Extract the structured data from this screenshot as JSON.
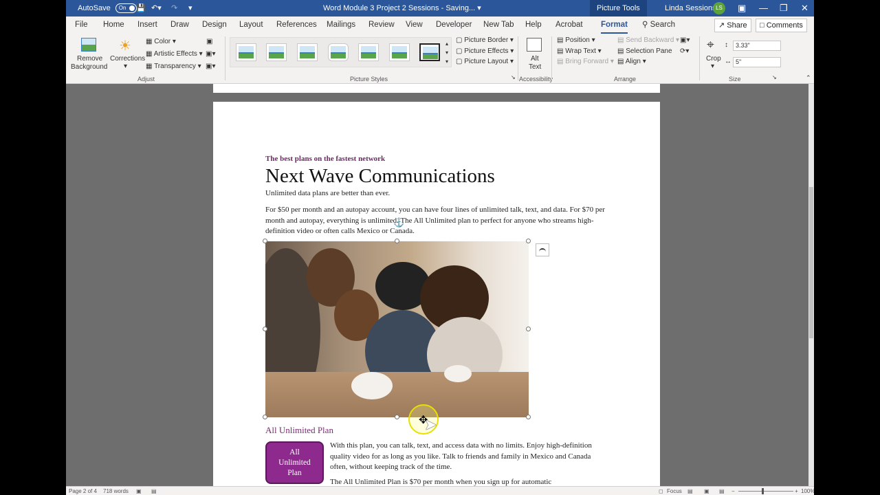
{
  "titlebar": {
    "autosave_label": "AutoSave",
    "autosave_state": "On",
    "document_title": "Word Module 3 Project 2 Sessions  -  Saving...",
    "context_tab": "Picture Tools",
    "user_name": "Linda Sessions",
    "user_initials": "LS"
  },
  "tabs": [
    {
      "label": "File"
    },
    {
      "label": "Home"
    },
    {
      "label": "Insert"
    },
    {
      "label": "Draw"
    },
    {
      "label": "Design"
    },
    {
      "label": "Layout"
    },
    {
      "label": "References"
    },
    {
      "label": "Mailings"
    },
    {
      "label": "Review"
    },
    {
      "label": "View"
    },
    {
      "label": "Developer"
    },
    {
      "label": "New Tab"
    },
    {
      "label": "Help"
    },
    {
      "label": "Acrobat"
    },
    {
      "label": "Format"
    }
  ],
  "search_label": "Search",
  "share_label": "Share",
  "comments_label": "Comments",
  "ribbon": {
    "remove_background_1": "Remove",
    "remove_background_2": "Background",
    "corrections": "Corrections",
    "color": "Color",
    "artistic_effects": "Artistic Effects",
    "transparency": "Transparency",
    "adjust_group": "Adjust",
    "picture_border": "Picture Border",
    "picture_effects": "Picture Effects",
    "picture_layout": "Picture Layout",
    "picture_styles_group": "Picture Styles",
    "alt_text_1": "Alt",
    "alt_text_2": "Text",
    "accessibility_group": "Accessibility",
    "position": "Position",
    "wrap_text": "Wrap Text",
    "bring_forward": "Bring Forward",
    "send_backward": "Send Backward",
    "selection_pane": "Selection Pane",
    "align": "Align",
    "arrange_group": "Arrange",
    "crop": "Crop",
    "height": "3.33\"",
    "width": "5\"",
    "size_group": "Size"
  },
  "document": {
    "tagline": "The best plans on the fastest network",
    "heading": "Next Wave Communications",
    "subtitle": "Unlimited data plans are better than ever.",
    "para1": "For $50 per month and an autopay account, you can have four lines of unlimited talk, text, and data. For $70 per month and autopay, everything is unlimited. The All Unlimited plan to perfect for anyone who streams high-definition video or often calls Mexico or Canada.",
    "section_heading": "All Unlimited Plan",
    "badge_line1": "All",
    "badge_line2": "Unlimited",
    "badge_line3": "Plan",
    "para2": "With this plan, you can talk, text, and access data with no limits. Enjoy high-definition quality video for as long as you like. Talk to friends and family in Mexico and Canada often, without keeping track of the time.",
    "para3": "The All Unlimited Plan is $70 per month when you sign up for automatic"
  },
  "status": {
    "page": "Page 2 of 4",
    "words": "718 words",
    "focus": "Focus",
    "zoom": "100%"
  },
  "colors": {
    "title_bar": "#2b579a",
    "accent_purple": "#8e2a8d",
    "tagline_purple": "#6b2a63"
  }
}
